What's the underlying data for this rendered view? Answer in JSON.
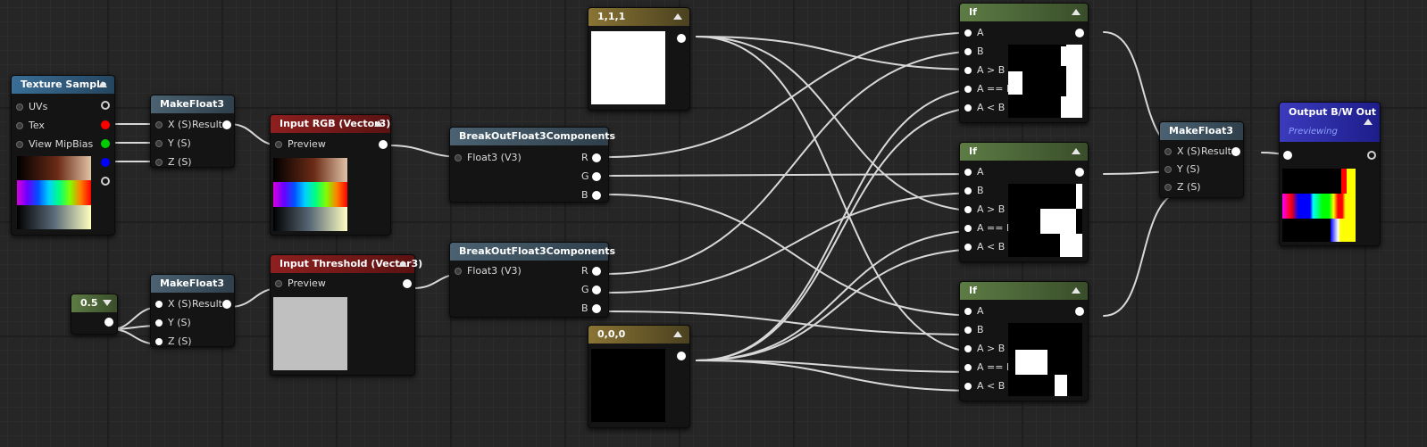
{
  "nodes": {
    "texture_sample": {
      "title": "Texture Sample",
      "uvs": "UVs",
      "tex": "Tex",
      "view_mip_bias": "View MipBias"
    },
    "makefloat3_top": {
      "title": "MakeFloat3",
      "x": "X (S)",
      "y": "Y (S)",
      "z": "Z (S)",
      "result": "Result"
    },
    "input_rgb": {
      "title": "Input RGB (Vector3)",
      "preview": "Preview"
    },
    "breakout_top": {
      "title": "BreakOutFloat3Components",
      "input": "Float3 (V3)",
      "r": "R",
      "g": "G",
      "b": "B"
    },
    "const_111": {
      "title": "1,1,1"
    },
    "const_000": {
      "title": "0,0,0"
    },
    "scalar": {
      "title": "0.5"
    },
    "makefloat3_bottom": {
      "title": "MakeFloat3",
      "x": "X (S)",
      "y": "Y (S)",
      "z": "Z (S)",
      "result": "Result"
    },
    "input_threshold": {
      "title": "Input Threshold (Vector3)",
      "preview": "Preview"
    },
    "breakout_bottom": {
      "title": "BreakOutFloat3Components",
      "input": "Float3 (V3)",
      "r": "R",
      "g": "G",
      "b": "B"
    },
    "if_nodes": [
      {
        "title": "If",
        "a": "A",
        "b": "B",
        "agtb": "A > B",
        "aeqb": "A == B",
        "altb": "A < B"
      },
      {
        "title": "If",
        "a": "A",
        "b": "B",
        "agtb": "A > B",
        "aeqb": "A == B",
        "altb": "A < B"
      },
      {
        "title": "If",
        "a": "A",
        "b": "B",
        "agtb": "A > B",
        "aeqb": "A == B",
        "altb": "A < B"
      }
    ],
    "makefloat3_right": {
      "title": "MakeFloat3",
      "x": "X (S)",
      "y": "Y (S)",
      "z": "Z (S)",
      "result": "Result"
    },
    "output": {
      "title": "Output B/W Out",
      "status": "Previewing"
    }
  },
  "colors": {
    "canvas_bg": "#262626",
    "pin_red": "#ff0000",
    "pin_green": "#00cc00",
    "pin_blue": "#0000ff",
    "threshold_preview": "#c0c0c0"
  },
  "icons": [
    "collapse-triangle-icon",
    "expand-triangle-icon",
    "pin-dot-icon"
  ]
}
